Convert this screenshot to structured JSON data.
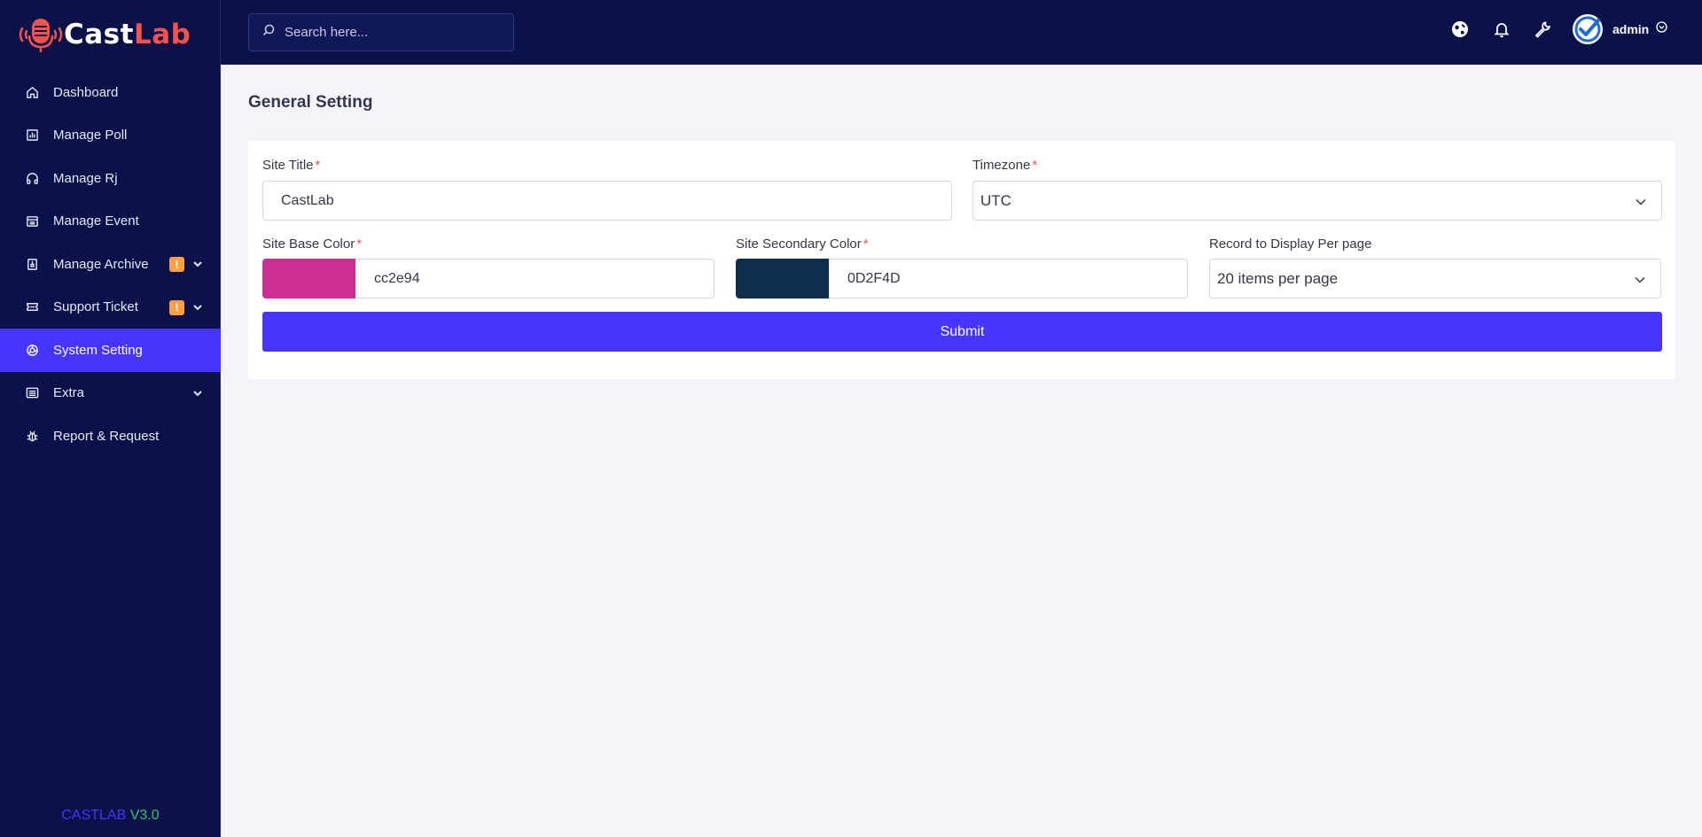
{
  "brand": {
    "name_part1": "Cast",
    "name_part2": "Lab",
    "version_label": "CASTLAB",
    "version_number": "V3.0"
  },
  "search": {
    "placeholder": "Search here..."
  },
  "topbar": {
    "user_name": "admin"
  },
  "sidebar": {
    "items": [
      {
        "label": "Dashboard",
        "icon": "home-icon"
      },
      {
        "label": "Manage Poll",
        "icon": "chart-icon"
      },
      {
        "label": "Manage Rj",
        "icon": "headphones-icon"
      },
      {
        "label": "Manage Event",
        "icon": "calendar-icon"
      },
      {
        "label": "Manage Archive",
        "icon": "archive-icon",
        "badge": "!",
        "has_submenu": true
      },
      {
        "label": "Support Ticket",
        "icon": "ticket-icon",
        "badge": "!",
        "has_submenu": true
      },
      {
        "label": "System Setting",
        "icon": "settings-icon",
        "active": true
      },
      {
        "label": "Extra",
        "icon": "list-icon",
        "has_submenu": true
      },
      {
        "label": "Report & Request",
        "icon": "bug-icon"
      }
    ]
  },
  "main": {
    "page_title": "General Setting",
    "form": {
      "site_title_label": "Site Title",
      "site_title_value": "CastLab",
      "timezone_label": "Timezone",
      "timezone_value": "UTC",
      "base_color_label": "Site Base Color",
      "base_color_value": "cc2e94",
      "secondary_color_label": "Site Secondary Color",
      "secondary_color_value": "0D2F4D",
      "per_page_label": "Record to Display Per page",
      "per_page_value": "20 items per page",
      "required_mark": "*",
      "submit_label": "Submit"
    }
  },
  "colors": {
    "sidebar_bg": "#0b1149",
    "accent": "#4634ff",
    "base_color_swatch": "#cc2e94",
    "secondary_color_swatch": "#0d2f4d",
    "badge": "#ff9f43"
  }
}
